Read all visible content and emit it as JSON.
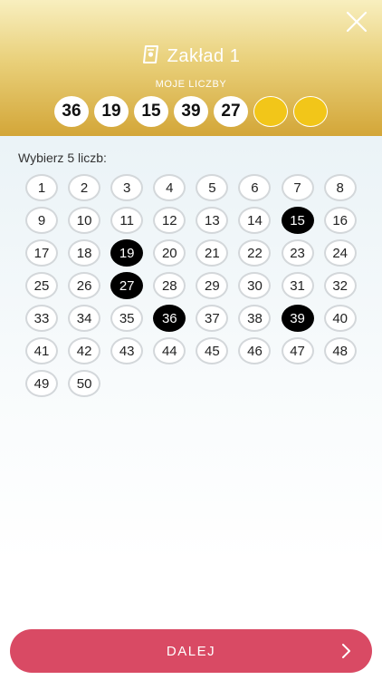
{
  "header": {
    "title": "Zakład 1",
    "subtitle": "MOJE LICZBY",
    "title_icon": "ticket-icon",
    "close_icon": "close-icon",
    "selected_numbers": [
      "36",
      "19",
      "15",
      "39",
      "27",
      "",
      ""
    ]
  },
  "picker": {
    "label": "Wybierz 5 liczb:",
    "numbers": [
      "1",
      "2",
      "3",
      "4",
      "5",
      "6",
      "7",
      "8",
      "9",
      "10",
      "11",
      "12",
      "13",
      "14",
      "15",
      "16",
      "17",
      "18",
      "19",
      "20",
      "21",
      "22",
      "23",
      "24",
      "25",
      "26",
      "27",
      "28",
      "29",
      "30",
      "31",
      "32",
      "33",
      "34",
      "35",
      "36",
      "37",
      "38",
      "39",
      "40",
      "41",
      "42",
      "43",
      "44",
      "45",
      "46",
      "47",
      "48",
      "49",
      "50"
    ],
    "selected": [
      "15",
      "19",
      "27",
      "36",
      "39"
    ]
  },
  "footer": {
    "next_label": "DALEJ",
    "next_icon": "chevron-right-icon"
  },
  "colors": {
    "accent": "#d94a64",
    "gold": "#f2c619",
    "selected": "#000000"
  }
}
